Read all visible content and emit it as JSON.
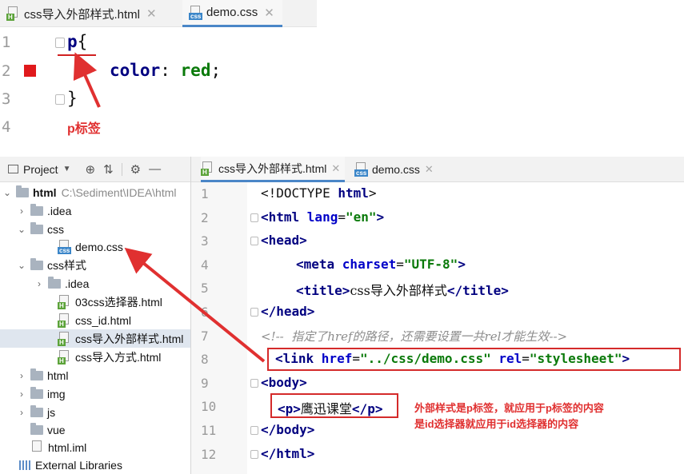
{
  "top_editor": {
    "tabs": [
      {
        "label": "css导入外部样式.html",
        "icon": "html-file-icon",
        "active": false
      },
      {
        "label": "demo.css",
        "icon": "css-file-icon",
        "active": true
      }
    ],
    "lines": [
      {
        "num": "1",
        "selector": "p",
        "brace": "{"
      },
      {
        "num": "2",
        "property": "color",
        "colon": ":",
        "value": "red",
        "semi": ";"
      },
      {
        "num": "3",
        "brace": "}"
      },
      {
        "num": "4"
      }
    ],
    "annotation": "p标签"
  },
  "project_panel": {
    "toolbar": {
      "title": "Project",
      "icons": [
        "target-icon",
        "collapse-icon",
        "gear-icon",
        "minimize-icon"
      ]
    },
    "tree": [
      {
        "name": "html",
        "path": "C:\\Sediment\\IDEA\\html"
      },
      {
        "name": ".idea"
      },
      {
        "name": "css"
      },
      {
        "name": "demo.css"
      },
      {
        "name": "css样式"
      },
      {
        "name": ".idea"
      },
      {
        "name": "03css选择器.html"
      },
      {
        "name": "css_id.html"
      },
      {
        "name": "css导入外部样式.html"
      },
      {
        "name": "css导入方式.html"
      },
      {
        "name": "html"
      },
      {
        "name": "img"
      },
      {
        "name": "js"
      },
      {
        "name": "vue"
      },
      {
        "name": "html.iml"
      },
      {
        "name": "External Libraries"
      }
    ]
  },
  "bottom_editor": {
    "tabs": [
      {
        "label": "css导入外部样式.html",
        "icon": "html-file-icon",
        "active": true
      },
      {
        "label": "demo.css",
        "icon": "css-file-icon",
        "active": false
      }
    ],
    "lines": [
      {
        "num": "1",
        "t1": "<!DOCTYPE ",
        "t2": "html",
        "t3": ">"
      },
      {
        "num": "2",
        "t1": "<html ",
        "a1": "lang",
        "eq": "=",
        "s1": "\"en\"",
        "t3": ">"
      },
      {
        "num": "3",
        "t1": "<head>"
      },
      {
        "num": "4",
        "t1": "<meta ",
        "a1": "charset",
        "eq": "=",
        "s1": "\"UTF-8\"",
        "t3": ">"
      },
      {
        "num": "5",
        "t1": "<title>",
        "text": "css导入外部样式",
        "t3": "</title>"
      },
      {
        "num": "6",
        "t1": "</head>"
      },
      {
        "num": "7",
        "comment": "<!--  指定了href的路径，还需要设置一共rel才能生效-->"
      },
      {
        "num": "8",
        "t1": "<link ",
        "a1": "href",
        "eq": "=",
        "s1": "\"../css/demo.css\"",
        "a2": " rel",
        "eq2": "=",
        "s2": "\"stylesheet\"",
        "t3": ">"
      },
      {
        "num": "9",
        "t1": "<body>"
      },
      {
        "num": "10",
        "t1": "<p>",
        "text": "鹰迅课堂",
        "t3": "</p>"
      },
      {
        "num": "11",
        "t1": "</body>"
      },
      {
        "num": "12",
        "t1": "</html>"
      }
    ],
    "note_lines": [
      "外部样式是p标签，就应用于p标签的内容",
      "是id选择器就应用于id选择器的内容"
    ]
  },
  "colors": {
    "annotation_red": "#e03030",
    "tag_blue": "#000080",
    "string_green": "#0a7a0a",
    "selection": "#dfe6ef"
  }
}
